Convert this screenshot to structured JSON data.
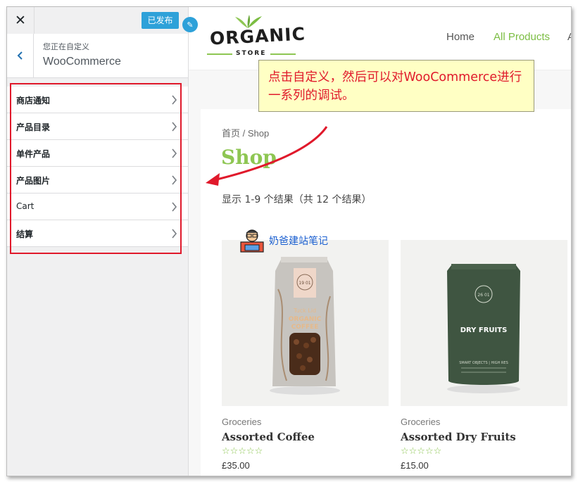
{
  "sidebar": {
    "close_label": "✕",
    "publish_label": "已发布",
    "panel_sub": "您正在自定义",
    "panel_title": "WooCommerce",
    "back_icon": "chevron-left-icon",
    "items": [
      {
        "label": "商店通知"
      },
      {
        "label": "产品目录"
      },
      {
        "label": "单件产品"
      },
      {
        "label": "产品图片"
      },
      {
        "label": "Cart"
      },
      {
        "label": "结算"
      }
    ]
  },
  "site": {
    "logo_main": "ORGANIC",
    "logo_sub": "STORE",
    "nav": {
      "home": "Home",
      "products": "All Products",
      "more": "A"
    },
    "breadcrumb": "首页 / Shop",
    "title": "Shop",
    "result_count": "显示 1-9 个结果（共 12 个结果）",
    "products": [
      {
        "category": "Groceries",
        "name": "Assorted Coffee",
        "stars": "☆☆☆☆☆",
        "price": "£35.00",
        "pack_line1": "Tuck Lid",
        "pack_line2": "ORGANIC",
        "pack_line3": "COFFEE",
        "badge": "19\n01"
      },
      {
        "category": "Groceries",
        "name": "Assorted Dry Fruits",
        "stars": "☆☆☆☆☆",
        "price": "£15.00",
        "pack_line1": "DRY FRUITS",
        "pack_line2": "SMART OBJECTS | HIGH RES",
        "badge": "26\n01"
      }
    ]
  },
  "annotation": {
    "callout_text": "点击自定义，然后可以对WooCommerce进行一系列的调试。",
    "watermark": "奶爸建站笔记"
  },
  "colors": {
    "accent_green": "#8ec653",
    "publish_blue": "#2ea1d9",
    "annotation_red": "#e0192b",
    "callout_bg": "#ffffc4"
  }
}
